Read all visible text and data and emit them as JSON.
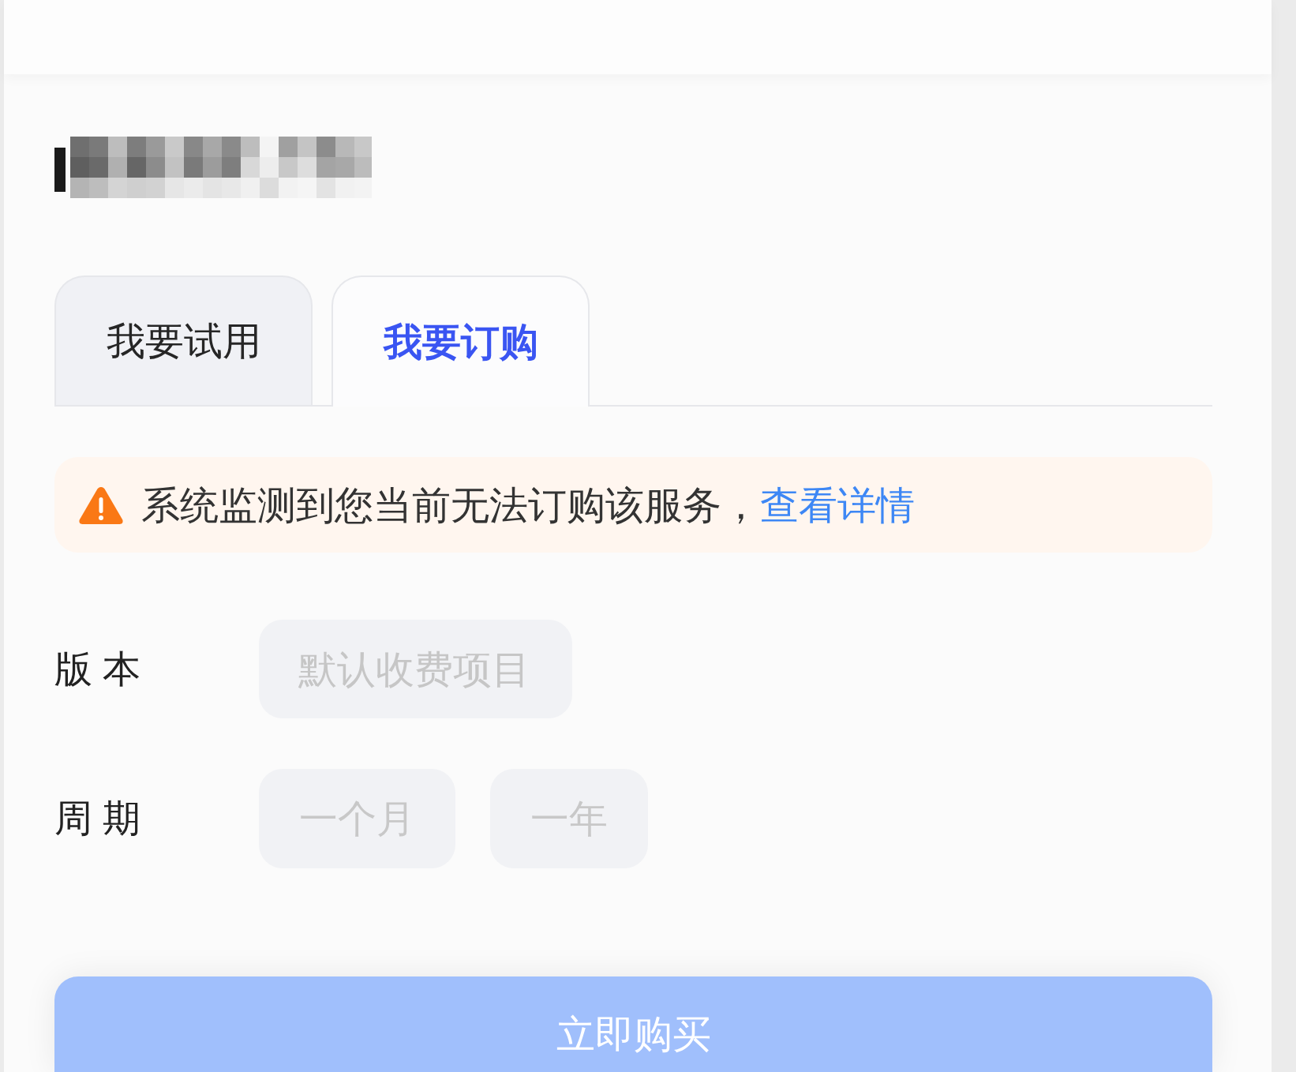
{
  "tabs": [
    {
      "label": "我要试用",
      "selected": false
    },
    {
      "label": "我要订购",
      "selected": true
    }
  ],
  "notice": {
    "text": "系统监测到您当前无法订购该服务，",
    "link": "查看详情"
  },
  "form": {
    "version": {
      "label": "版 本",
      "placeholder": "默认收费项目",
      "disabled": true
    },
    "period": {
      "label": "周 期",
      "options": [
        {
          "label": "一个月",
          "selected": false,
          "disabled": true
        },
        {
          "label": "一年",
          "selected": false,
          "disabled": true
        }
      ]
    }
  },
  "buy_button": {
    "label": "立即购买",
    "disabled": true
  }
}
